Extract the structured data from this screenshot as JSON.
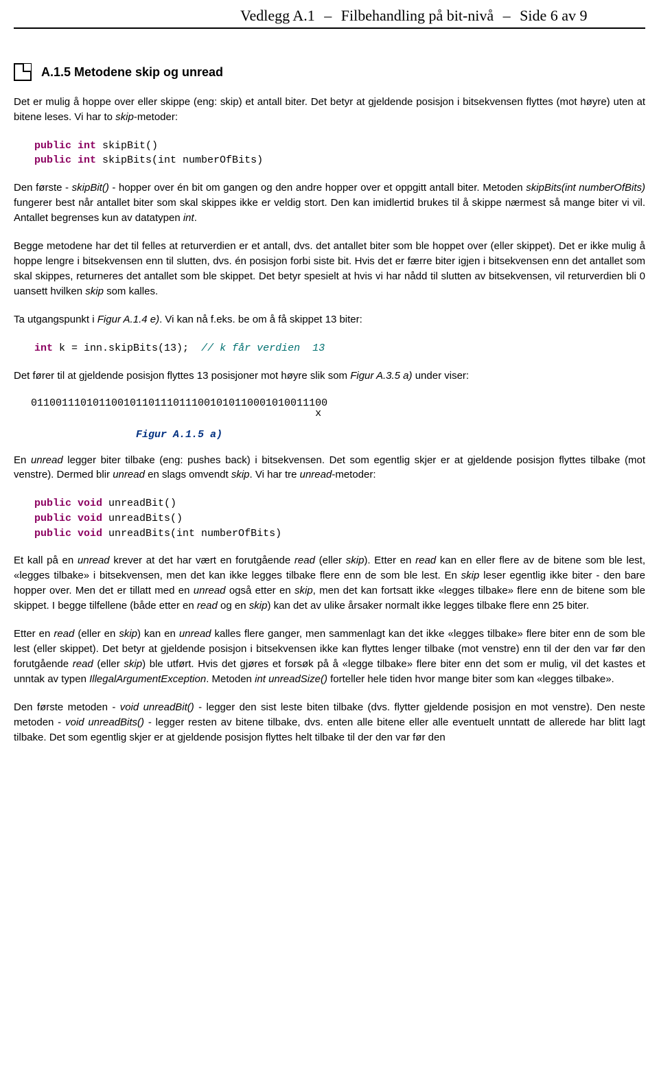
{
  "header": {
    "appendix": "Vedlegg A.1",
    "dash": "–",
    "title": "Filbehandling på bit-nivå",
    "page": "Side 6 av 9"
  },
  "section": {
    "title": "A.1.5  Metodene skip og unread"
  },
  "para1_pre": "Det er mulig å hoppe over eller skippe (eng: skip) et antall biter. Det betyr at gjeldende posisjon i bitsekvensen flyttes (mot høyre) uten at bitene leses. Vi har to ",
  "para1_it": "skip",
  "para1_post": "-metoder:",
  "code1_kw1": "public int ",
  "code1_fn1": "skipBit()",
  "code1_kw2": "public int ",
  "code1_fn2": "skipBits(int numberOfBits)",
  "para2_a": "Den første - ",
  "para2_i1": "skipBit()",
  "para2_b": " - hopper over én bit om gangen og den andre hopper over et oppgitt antall biter. Metoden ",
  "para2_i2": "skipBits(int numberOfBits)",
  "para2_c": " fungerer best når antallet biter som skal skippes ikke er veldig stort. Den kan imidlertid brukes til å skippe nærmest så mange biter vi vil. Antallet begrenses kun av datatypen ",
  "para2_i3": "int",
  "para2_d": ".",
  "para3_a": "Begge metodene har det til felles at returverdien er et antall, dvs. det antallet biter som ble hoppet over (eller skippet). Det er ikke mulig å hoppe lengre i bitsekvensen enn til slutten, dvs. én posisjon forbi siste bit. Hvis det er færre biter igjen i bitsekvensen enn det antallet som skal skippes, returneres det antallet som ble skippet. Det betyr spesielt at hvis vi har nådd til slutten av bitsekvensen, vil returverdien bli 0 uansett hvilken ",
  "para3_i1": "skip",
  "para3_b": " som kalles.",
  "para4_a": "Ta utgangspunkt i ",
  "para4_i1": "Figur A.1.4 e)",
  "para4_b": ". Vi kan nå f.eks. be om å få skippet 13 biter:",
  "code2_kw": "int",
  "code2_body": " k = inn.skipBits(13);  ",
  "code2_cm": "// k får verdien  13",
  "para5_a": "Det fører til at gjeldende posisjon flyttes 13 posisjoner mot høyre slik som ",
  "para5_i1": "Figur A.3.5 a)",
  "para5_b": " under viser:",
  "bits": "011001110101100101101110111001010110001010011100",
  "bits_x": "                                              x",
  "fig_caption": "Figur A.1.5 a)",
  "para6_a": "En ",
  "para6_i1": "unread",
  "para6_b": " legger biter tilbake (eng: pushes back) i bitsekvensen. Det som egentlig skjer er at gjeldende posisjon flyttes tilbake (mot venstre). Dermed blir ",
  "para6_i2": "unread",
  "para6_c": " en slags omvendt ",
  "para6_i3": "skip",
  "para6_d": ". Vi har tre ",
  "para6_i4": "unread",
  "para6_e": "-metoder:",
  "code3_kw1": "public void ",
  "code3_fn1": "unreadBit()",
  "code3_kw2": "public void ",
  "code3_fn2": "unreadBits()",
  "code3_kw3": "public void ",
  "code3_fn3": "unreadBits(int numberOfBits)",
  "para7_a": "Et kall på en ",
  "para7_i1": "unread",
  "para7_b": " krever at det har vært en forutgående ",
  "para7_i2": "read",
  "para7_c": " (eller ",
  "para7_i3": "skip",
  "para7_d": "). Etter en ",
  "para7_i4": "read",
  "para7_e": " kan en eller flere av de bitene som ble lest, «legges tilbake» i bitsekvensen, men det kan ikke legges tilbake flere enn de som ble lest. En ",
  "para7_i5": "skip",
  "para7_f": " leser egentlig ikke biter - den bare hopper over. Men det er tillatt med en ",
  "para7_i6": "unread",
  "para7_g": " også etter en ",
  "para7_i7": "skip",
  "para7_h": ", men det kan fortsatt ikke «legges tilbake» flere enn de bitene som ble skippet. I begge tilfellene (både etter en ",
  "para7_i8": "read",
  "para7_j": " og en ",
  "para7_i9": "skip",
  "para7_k": ") kan det av ulike årsaker normalt ikke legges tilbake flere enn 25 biter.",
  "para8_a": "Etter en ",
  "para8_i1": "read",
  "para8_b": " (eller en ",
  "para8_i2": "skip",
  "para8_c": ") kan en ",
  "para8_i3": "unread",
  "para8_d": " kalles flere ganger, men sammenlagt kan det ikke «legges tilbake» flere biter enn de som ble lest (eller skippet). Det betyr at gjeldende posisjon i bitsekvensen ikke kan flyttes lenger tilbake (mot venstre) enn til der den var før den forutgående ",
  "para8_i4": "read",
  "para8_e": " (eller ",
  "para8_i5": "skip",
  "para8_f": ") ble utført. Hvis det gjøres et forsøk på å «legge tilbake» flere biter enn det som er mulig, vil det kastes et unntak av typen ",
  "para8_i6": "IllegalArgumentException",
  "para8_g": ". Metoden ",
  "para8_i7": "int unreadSize()",
  "para8_h": " forteller hele tiden hvor mange biter som kan «legges tilbake».",
  "para9_a": "Den første metoden - ",
  "para9_i1": "void unreadBit()",
  "para9_b": " - legger den sist leste biten tilbake (dvs. flytter gjeldende posisjon en mot venstre). Den neste metoden - ",
  "para9_i2": "void unreadBits()",
  "para9_c": " - legger resten av bitene tilbake, dvs. enten alle bitene eller alle eventuelt unntatt de allerede har blitt lagt tilbake. Det som egentlig skjer er at gjeldende posisjon flyttes helt tilbake til der den var før den"
}
